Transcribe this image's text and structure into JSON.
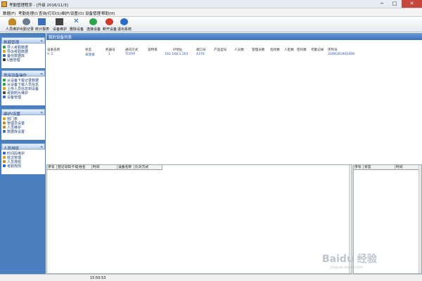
{
  "window": {
    "title": "考勤管理程序 - [升级 2016/11/3]"
  },
  "menu": [
    "数据(F)",
    "考勤处理(I)",
    "查询/打印(S)",
    "维护/设置(O)",
    "设备管理",
    "帮助(H)"
  ],
  "toolbar": [
    {
      "label": "人员维护",
      "icon": "people-icon",
      "color": "#c08a2a"
    },
    {
      "label": "出勤记录",
      "icon": "clock-icon",
      "color": "#6d7c8c"
    },
    {
      "label": "统计报表",
      "icon": "report-icon",
      "color": "#3b6fb7"
    },
    {
      "label": "设备维护",
      "icon": "device-icon",
      "color": "#444444"
    },
    {
      "label": "删除设备",
      "icon": "delete-icon",
      "color": "#2a63b8"
    },
    {
      "label": "连接设备",
      "icon": "connect-icon",
      "color": "#2aa44a"
    },
    {
      "label": "断开设备",
      "icon": "disconnect-icon",
      "color": "#d03a2a"
    },
    {
      "label": "退出系统",
      "icon": "exit-icon",
      "color": "#2a6dc9"
    }
  ],
  "sidebar": {
    "sections": [
      {
        "title": "数据管理",
        "items": [
          "导入考勤数据",
          "导出考勤数据",
          "备份数据库",
          "U盘管理"
        ]
      },
      {
        "title": "常用设备操作",
        "items": [
          "从设备下载记录数据",
          "从设备下载人员信息",
          "上传人员信息到设备",
          "考勤照片维护",
          "设备管理"
        ]
      },
      {
        "title": "维护/设置",
        "items": [
          "部门表",
          "管理员设置",
          "人员维护",
          "数据库设置"
        ]
      },
      {
        "title": "人员排班",
        "items": [
          "时间段维护",
          "班次管理",
          "人员排班",
          "考勤规则"
        ]
      }
    ]
  },
  "device_list": {
    "title": "我的设备列表",
    "columns": [
      "设备名称",
      "状态",
      "机器号",
      "通讯方式",
      "波特率",
      "IP地址",
      "端口号",
      "产品型号",
      "人员数",
      "管理员数",
      "指纹数",
      "人脸数",
      "密码数",
      "考勤记录",
      "序列号"
    ],
    "rows": [
      {
        "name": "2",
        "status": "未连接",
        "machine_no": "1",
        "comm": "TCP/IP",
        "baud": "",
        "ip": "192.168.1.201",
        "port": "4370",
        "model": "",
        "users": "",
        "admins": "",
        "fingerprints": "",
        "faces": "",
        "passwords": "",
        "records": "",
        "serial": "3399161901699"
      }
    ]
  },
  "records_table": {
    "columns": [
      "序号",
      "登记号码卡号",
      "姓名",
      "时间",
      "设备名称",
      "比对方式"
    ]
  },
  "status_table": {
    "columns": [
      "序号",
      "状态",
      "时间"
    ]
  },
  "statusbar": {
    "time": "15:50:53"
  },
  "watermark": {
    "main": "Baidu 经验",
    "sub": "jingyan.baidu.com"
  }
}
